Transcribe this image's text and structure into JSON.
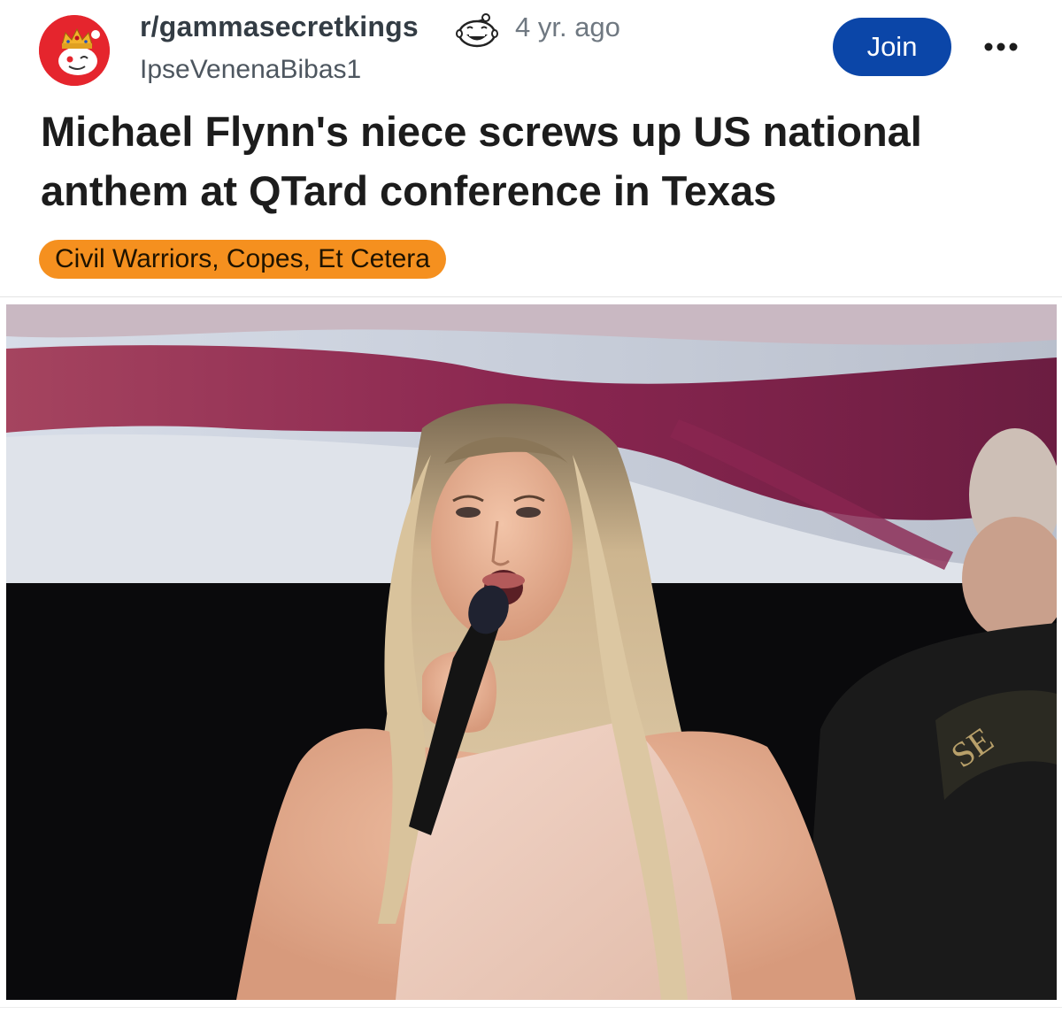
{
  "post": {
    "subreddit": "r/gammasecretkings",
    "time_ago": "4 yr. ago",
    "author": "IpseVenenaBibas1",
    "title": "Michael Flynn's niece screws up US national anthem at QTard conference in Texas",
    "flair": "Civil Warriors, Copes, Et Cetera",
    "join_label": "Join",
    "avatar_icon": "subreddit-avatar-icon",
    "award_icon": "laughing-snoo-icon",
    "more_icon": "ellipsis-icon"
  },
  "colors": {
    "join_button": "#0b46a8",
    "flair_background": "#f5901f",
    "avatar_background": "#e5252d"
  }
}
